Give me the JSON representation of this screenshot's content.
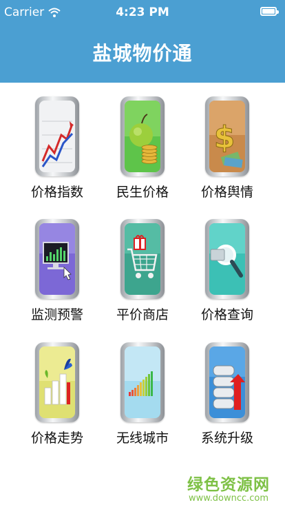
{
  "status_bar": {
    "carrier": "Carrier",
    "time": "4:23 PM"
  },
  "header": {
    "title": "盐城物价通"
  },
  "tiles": [
    {
      "label": "价格指数",
      "icon": "line-chart-icon"
    },
    {
      "label": "民生价格",
      "icon": "apple-coins-icon"
    },
    {
      "label": "价格舆情",
      "icon": "dollar-money-icon"
    },
    {
      "label": "监测预警",
      "icon": "monitor-chart-icon"
    },
    {
      "label": "平价商店",
      "icon": "shopping-cart-icon"
    },
    {
      "label": "价格查询",
      "icon": "magnifier-icon"
    },
    {
      "label": "价格走势",
      "icon": "bar-growth-icon"
    },
    {
      "label": "无线城市",
      "icon": "signal-bars-icon"
    },
    {
      "label": "系统升级",
      "icon": "database-upgrade-icon"
    }
  ],
  "watermark": {
    "name": "绿色资源网",
    "url": "www.downcc.com"
  },
  "colors": {
    "header": "#4b9fd2",
    "watermark": "#7ec146"
  }
}
